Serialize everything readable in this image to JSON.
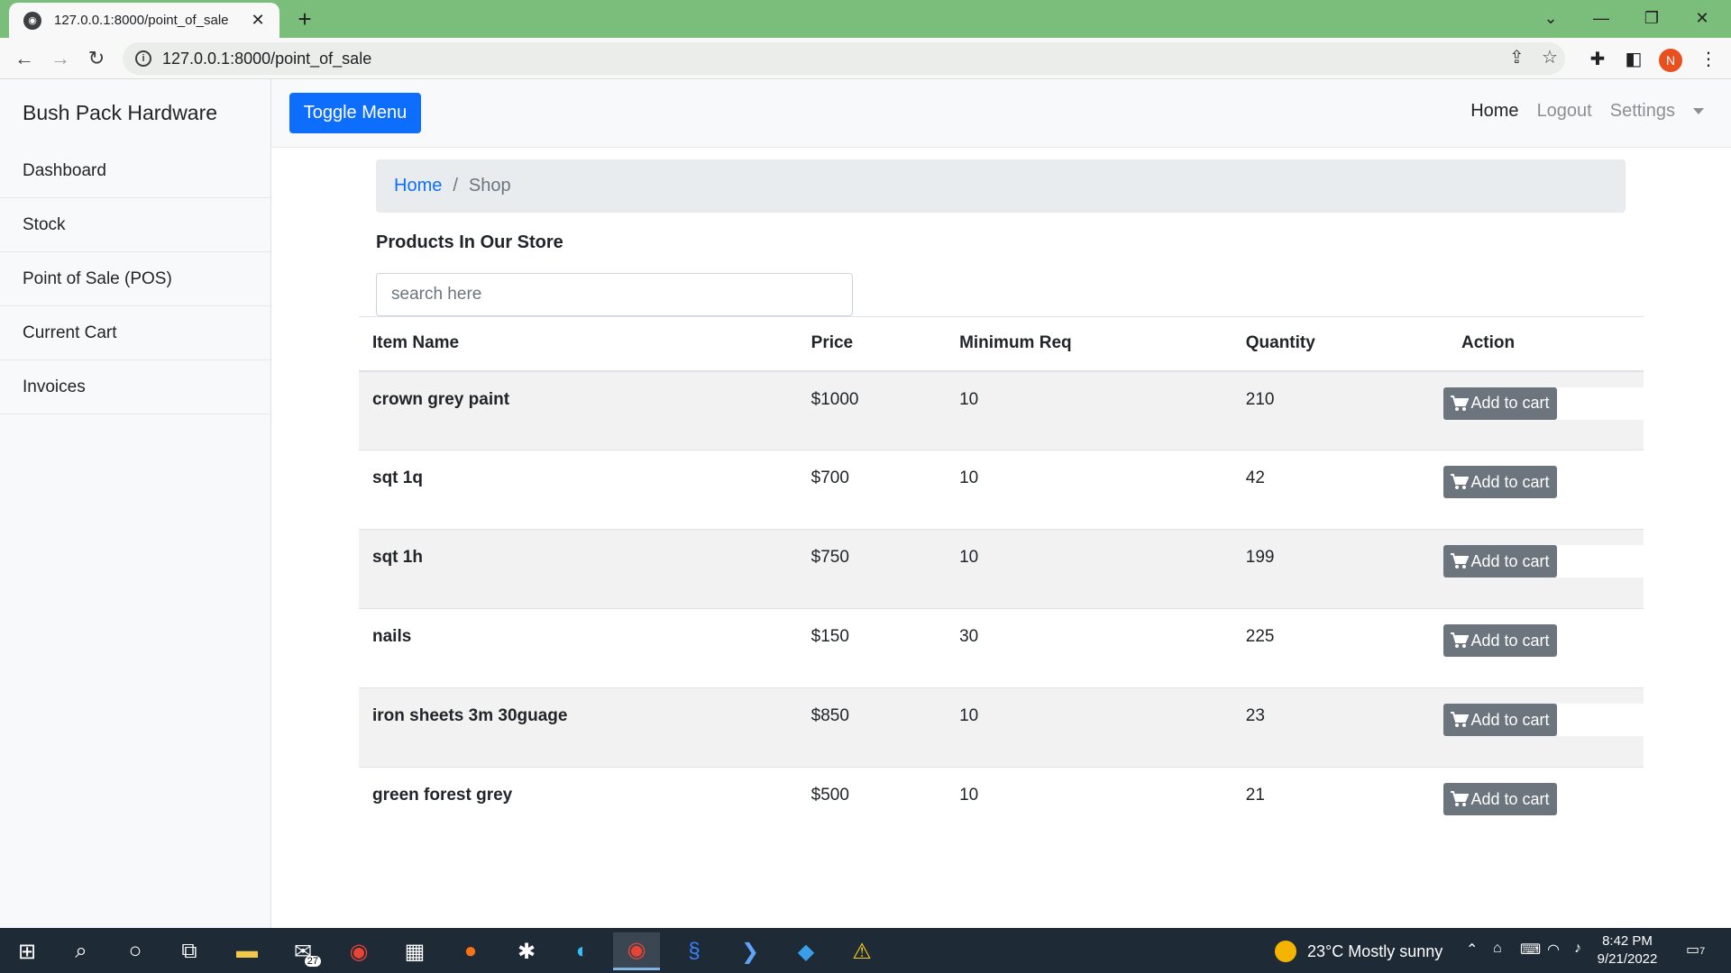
{
  "browser": {
    "tab_title": "127.0.0.1:8000/point_of_sale",
    "url": "127.0.0.1:8000/point_of_sale",
    "profile_initial": "N"
  },
  "sidebar": {
    "brand": "Bush Pack Hardware",
    "items": [
      {
        "label": "Dashboard"
      },
      {
        "label": "Stock"
      },
      {
        "label": "Point of Sale (POS)"
      },
      {
        "label": "Current Cart"
      },
      {
        "label": "Invoices"
      }
    ]
  },
  "topnav": {
    "toggle_label": "Toggle Menu",
    "home": "Home",
    "logout": "Logout",
    "settings": "Settings"
  },
  "breadcrumb": {
    "home": "Home",
    "separator": "/",
    "current": "Shop"
  },
  "main": {
    "title": "Products In Our Store",
    "search_placeholder": "search here",
    "columns": [
      "Item Name",
      "Price",
      "Minimum Req",
      "Quantity",
      "Action"
    ],
    "add_label": "Add to cart",
    "rows": [
      {
        "name": "crown grey paint",
        "price": "$1000",
        "min": "10",
        "qty": "210"
      },
      {
        "name": "sqt 1q",
        "price": "$700",
        "min": "10",
        "qty": "42"
      },
      {
        "name": "sqt 1h",
        "price": "$750",
        "min": "10",
        "qty": "199"
      },
      {
        "name": "nails",
        "price": "$150",
        "min": "30",
        "qty": "225"
      },
      {
        "name": "iron sheets 3m 30guage",
        "price": "$850",
        "min": "10",
        "qty": "23"
      },
      {
        "name": "green forest grey",
        "price": "$500",
        "min": "10",
        "qty": "21"
      }
    ]
  },
  "taskbar": {
    "mail_badge": "27",
    "weather": "23°C  Mostly sunny",
    "time": "8:42 PM",
    "date": "9/21/2022",
    "notification_count": "7"
  },
  "colors": {
    "tab_strip": "#7bbd7a",
    "primary": "#0d6efd",
    "secondary": "#6c757d",
    "taskbar": "#1e2a36"
  }
}
